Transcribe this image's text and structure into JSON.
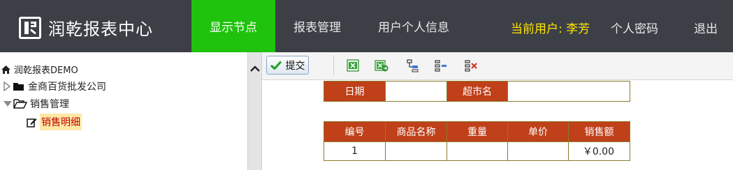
{
  "header": {
    "app_title": "润乾报表中心",
    "nav": [
      "显示节点",
      "报表管理",
      "用户个人信息"
    ],
    "current_user_label": "当前用户: 李芳",
    "password_label": "个人密码",
    "logout_label": "退出",
    "active_color": "#1fc20c"
  },
  "tree": {
    "root": "润乾报表DEMO",
    "nodes": [
      "金商百货批发公司",
      "销售管理"
    ],
    "selected": "销售明细"
  },
  "toolbar": {
    "submit_label": "提交",
    "icons": [
      "excel-import-icon",
      "excel-export-icon",
      "insert-row-icon",
      "append-row-icon",
      "delete-row-icon"
    ]
  },
  "report": {
    "filter_labels": [
      "日期",
      "超市名"
    ],
    "columns": [
      "编号",
      "商品名称",
      "重量",
      "单价",
      "销售额"
    ],
    "rows": [
      [
        "1",
        "",
        "",
        "",
        "￥0.00"
      ]
    ],
    "header_color": "#c0401a"
  }
}
